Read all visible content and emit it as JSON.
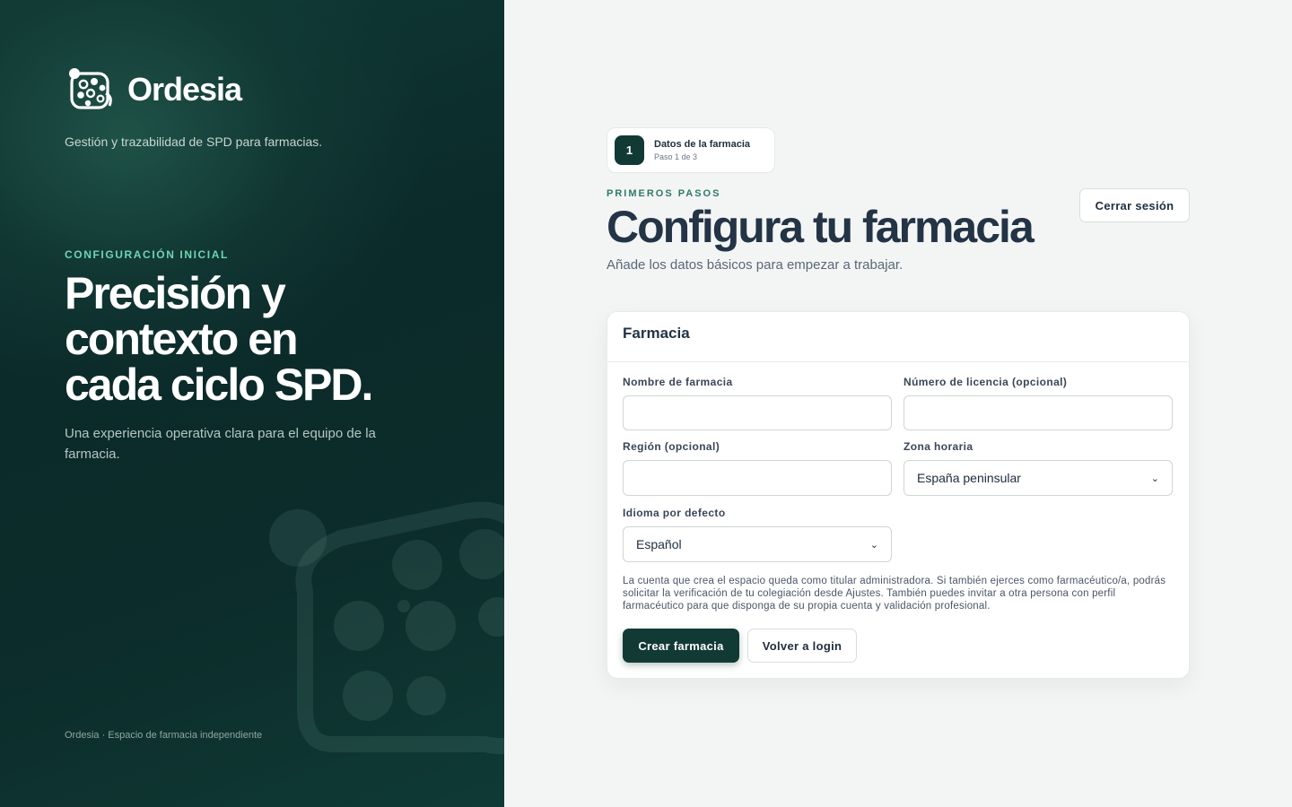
{
  "brand": {
    "name": "Ordesia",
    "tagline": "Gestión y trazabilidad de SPD para farmacias.",
    "logo_icon": "pill-organizer-icon"
  },
  "left": {
    "eyebrow": "CONFIGURACIÓN INICIAL",
    "hero_lines": [
      "Precisión y",
      "contexto en",
      "cada ciclo SPD."
    ],
    "subtitle": "Una experiencia operativa clara para el equipo de la farmacia.",
    "footer": "Ordesia · Espacio de farmacia independiente"
  },
  "step": {
    "number": "1",
    "title": "Datos de la farmacia",
    "subtitle": "Paso 1 de 3"
  },
  "header": {
    "eyebrow": "PRIMEROS PASOS",
    "title": "Configura tu farmacia",
    "subtitle": "Añade los datos básicos para empezar a trabajar.",
    "logout_label": "Cerrar sesión"
  },
  "form": {
    "card_title": "Farmacia",
    "fields": {
      "name": {
        "label": "Nombre de farmacia",
        "value": ""
      },
      "license": {
        "label": "Número de licencia (opcional)",
        "value": ""
      },
      "region": {
        "label": "Región (opcional)",
        "value": ""
      },
      "timezone": {
        "label": "Zona horaria",
        "selected": "España peninsular"
      },
      "language": {
        "label": "Idioma por defecto",
        "selected": "Español"
      }
    },
    "note": "La cuenta que crea el espacio queda como titular administradora. Si también ejerces como farmacéutico/a, podrás solicitar la verificación de tu colegiación desde Ajustes. También puedes invitar a otra persona con perfil farmacéutico para que disponga de su propia cuenta y validación profesional.",
    "submit_label": "Crear farmacia",
    "back_label": "Volver a login"
  },
  "colors": {
    "primary": "#123a35",
    "accent": "#6fd3b4",
    "eyebrow": "#2e7a6a",
    "sidebar_bg": "#0c2d2b"
  }
}
